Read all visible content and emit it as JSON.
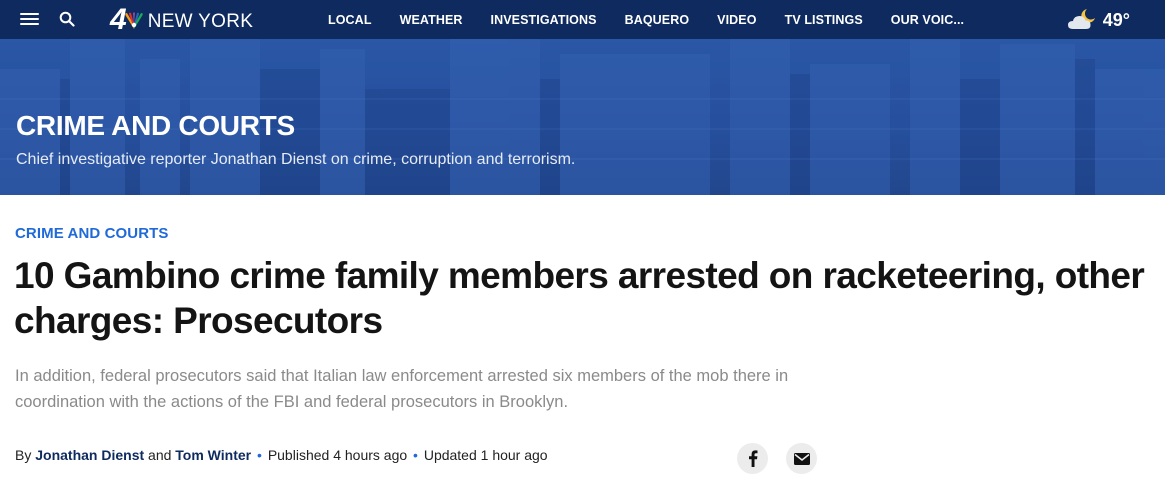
{
  "nav": {
    "logo_number": "4",
    "logo_text": "NEW YORK",
    "links": [
      "LOCAL",
      "WEATHER",
      "INVESTIGATIONS",
      "BAQUERO",
      "VIDEO",
      "TV LISTINGS",
      "OUR VOIC..."
    ],
    "weather": {
      "temperature": "49°",
      "icon": "partly-cloudy-night-icon"
    }
  },
  "hero": {
    "title": "CRIME AND COURTS",
    "subtitle": "Chief investigative reporter Jonathan Dienst on crime, corruption and terrorism."
  },
  "article": {
    "category": "CRIME AND COURTS",
    "headline": "10 Gambino crime family members arrested on racketeering, other charges: Prosecutors",
    "dek": "In addition, federal prosecutors said that Italian law enforcement arrested six members of the mob there in coordination with the actions of the FBI and federal prosecutors in Brooklyn.",
    "byline": {
      "by": "By",
      "author1": "Jonathan Dienst",
      "and": "and",
      "author2": "Tom Winter",
      "published": "Published 4 hours ago",
      "updated": "Updated 1 hour ago"
    },
    "share": {
      "facebook_icon": "facebook-icon",
      "email_icon": "email-icon"
    }
  },
  "colors": {
    "nav_bg": "#0e2a5e",
    "hero_bg": "#2a55a5",
    "accent": "#1f6ad8",
    "headline": "#141414",
    "dek": "#8a8a8a"
  }
}
